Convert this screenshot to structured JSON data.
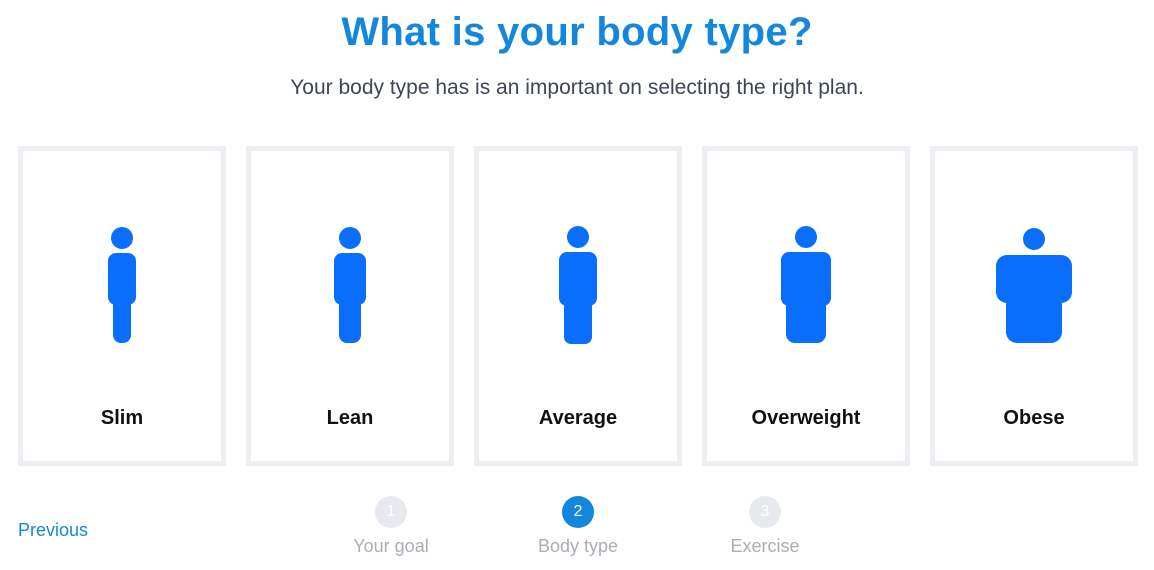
{
  "header": {
    "title": "What is your body type?",
    "subtitle": "Your body type has is an important on selecting the right plan."
  },
  "colors": {
    "accent": "#1387de",
    "figure": "#0a6efd",
    "card_border": "#eceef2",
    "step_inactive": "#e6e9ee"
  },
  "body_types": [
    {
      "label": "Slim",
      "icon": "slim-body-icon"
    },
    {
      "label": "Lean",
      "icon": "lean-body-icon"
    },
    {
      "label": "Average",
      "icon": "average-body-icon"
    },
    {
      "label": "Overweight",
      "icon": "overweight-body-icon"
    },
    {
      "label": "Obese",
      "icon": "obese-body-icon"
    }
  ],
  "navigation": {
    "previous_label": "Previous"
  },
  "steps": [
    {
      "number": "1",
      "label": "Your goal",
      "active": false
    },
    {
      "number": "2",
      "label": "Body type",
      "active": true
    },
    {
      "number": "3",
      "label": "Exercise",
      "active": false
    }
  ]
}
